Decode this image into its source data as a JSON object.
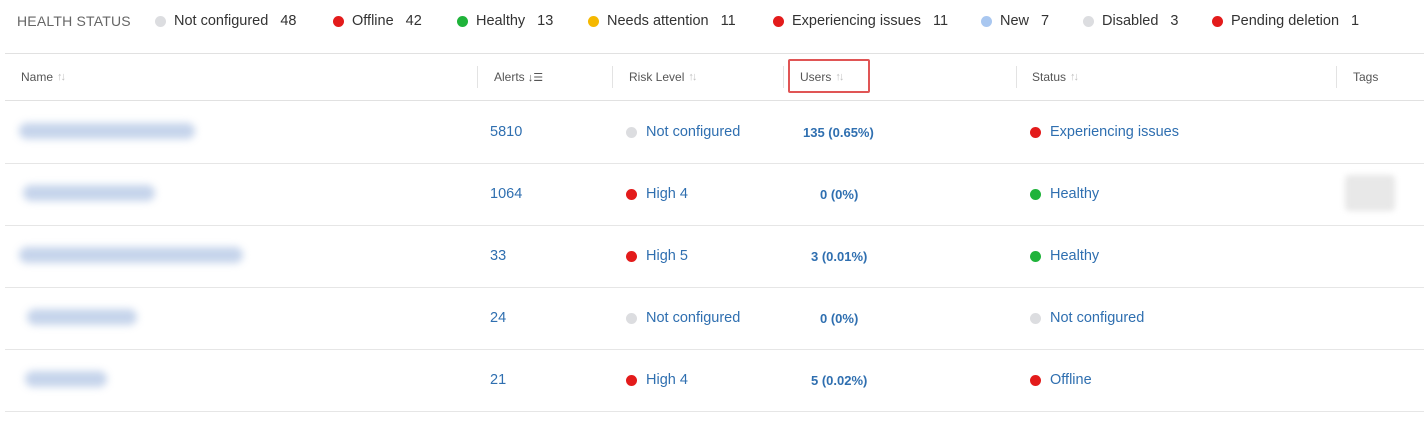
{
  "health": {
    "title": "HEALTH STATUS",
    "items": [
      {
        "label": "Not configured",
        "count": "48",
        "color": "#dcdde0"
      },
      {
        "label": "Offline",
        "count": "42",
        "color": "#e31b1b"
      },
      {
        "label": "Healthy",
        "count": "13",
        "color": "#1fb33a"
      },
      {
        "label": "Needs attention",
        "count": "11",
        "color": "#f5b800"
      },
      {
        "label": "Experiencing issues",
        "count": "11",
        "color": "#e31b1b"
      },
      {
        "label": "New",
        "count": "7",
        "color": "#a9c7f0"
      },
      {
        "label": "Disabled",
        "count": "3",
        "color": "#dcdde0"
      },
      {
        "label": "Pending deletion",
        "count": "1",
        "color": "#e31b1b"
      }
    ]
  },
  "table": {
    "columns": {
      "name": "Name",
      "alerts": "Alerts",
      "risk": "Risk Level",
      "users": "Users",
      "status": "Status",
      "tags": "Tags"
    },
    "rows": [
      {
        "alerts": "5810",
        "risk": "Not configured",
        "risk_color": "#dcdde0",
        "users": "135 (0.65%)",
        "status": "Experiencing issues",
        "status_color": "#e31b1b"
      },
      {
        "alerts": "1064",
        "risk": "High 4",
        "risk_color": "#e31b1b",
        "users": "0 (0%)",
        "status": "Healthy",
        "status_color": "#1fb33a"
      },
      {
        "alerts": "33",
        "risk": "High 5",
        "risk_color": "#e31b1b",
        "users": "3 (0.01%)",
        "status": "Healthy",
        "status_color": "#1fb33a"
      },
      {
        "alerts": "24",
        "risk": "Not configured",
        "risk_color": "#dcdde0",
        "users": "0 (0%)",
        "status": "Not configured",
        "status_color": "#dcdde0"
      },
      {
        "alerts": "21",
        "risk": "High 4",
        "risk_color": "#e31b1b",
        "users": "5 (0.02%)",
        "status": "Offline",
        "status_color": "#e31b1b"
      }
    ]
  },
  "icons": {
    "sort_neutral": "sort-icon",
    "sort_desc": "sort-descending-icon"
  }
}
